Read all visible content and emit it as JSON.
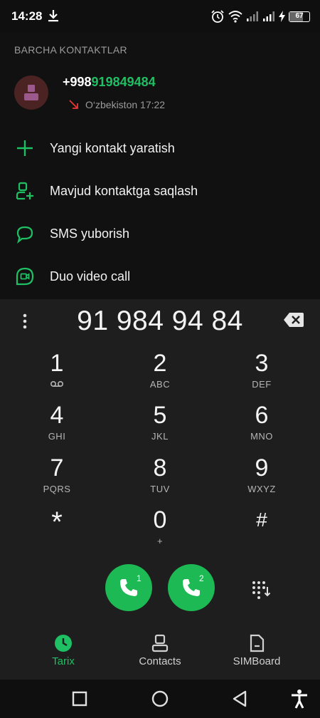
{
  "status_bar": {
    "time": "14:28",
    "battery": "67",
    "battery_level": 0.67,
    "icons": [
      "download-icon",
      "alarm-icon",
      "wifi-icon",
      "signal-icon",
      "signal-icon",
      "charging-icon",
      "battery-icon"
    ]
  },
  "section": {
    "label": "BARCHA KONTAKTLAR"
  },
  "contact": {
    "number_prefix": "+998",
    "number_match": "919849484",
    "detail": "O‘zbekiston 17:22",
    "call_type_icon": "missed-call-arrow-icon"
  },
  "actions": [
    {
      "label": "Yangi kontakt yaratish",
      "icon": "plus-icon"
    },
    {
      "label": "Mavjud kontaktga saqlash",
      "icon": "add-person-icon"
    },
    {
      "label": "SMS yuborish",
      "icon": "message-icon"
    },
    {
      "label": "Duo video call",
      "icon": "duo-video-icon"
    }
  ],
  "dialer": {
    "number": "91 984 94 84",
    "keys": [
      {
        "digit": "1",
        "letters": ""
      },
      {
        "digit": "2",
        "letters": "ABC"
      },
      {
        "digit": "3",
        "letters": "DEF"
      },
      {
        "digit": "4",
        "letters": "GHI"
      },
      {
        "digit": "5",
        "letters": "JKL"
      },
      {
        "digit": "6",
        "letters": "MNO"
      },
      {
        "digit": "7",
        "letters": "PQRS"
      },
      {
        "digit": "8",
        "letters": "TUV"
      },
      {
        "digit": "9",
        "letters": "WXYZ"
      },
      {
        "digit": "*",
        "letters": ""
      },
      {
        "digit": "0",
        "letters": "+"
      },
      {
        "digit": "#",
        "letters": ""
      }
    ],
    "call_sim1": "1",
    "call_sim2": "2"
  },
  "nav": {
    "items": [
      {
        "label": "Tarix",
        "icon": "clock-icon",
        "active": true
      },
      {
        "label": "Contacts",
        "icon": "contacts-icon",
        "active": false
      },
      {
        "label": "SIMBoard",
        "icon": "sim-card-icon",
        "active": false
      }
    ]
  },
  "colors": {
    "accent": "#1fbf63",
    "call_button": "#1db954",
    "background": "#111111",
    "dialer_background": "#1e1e1e"
  }
}
